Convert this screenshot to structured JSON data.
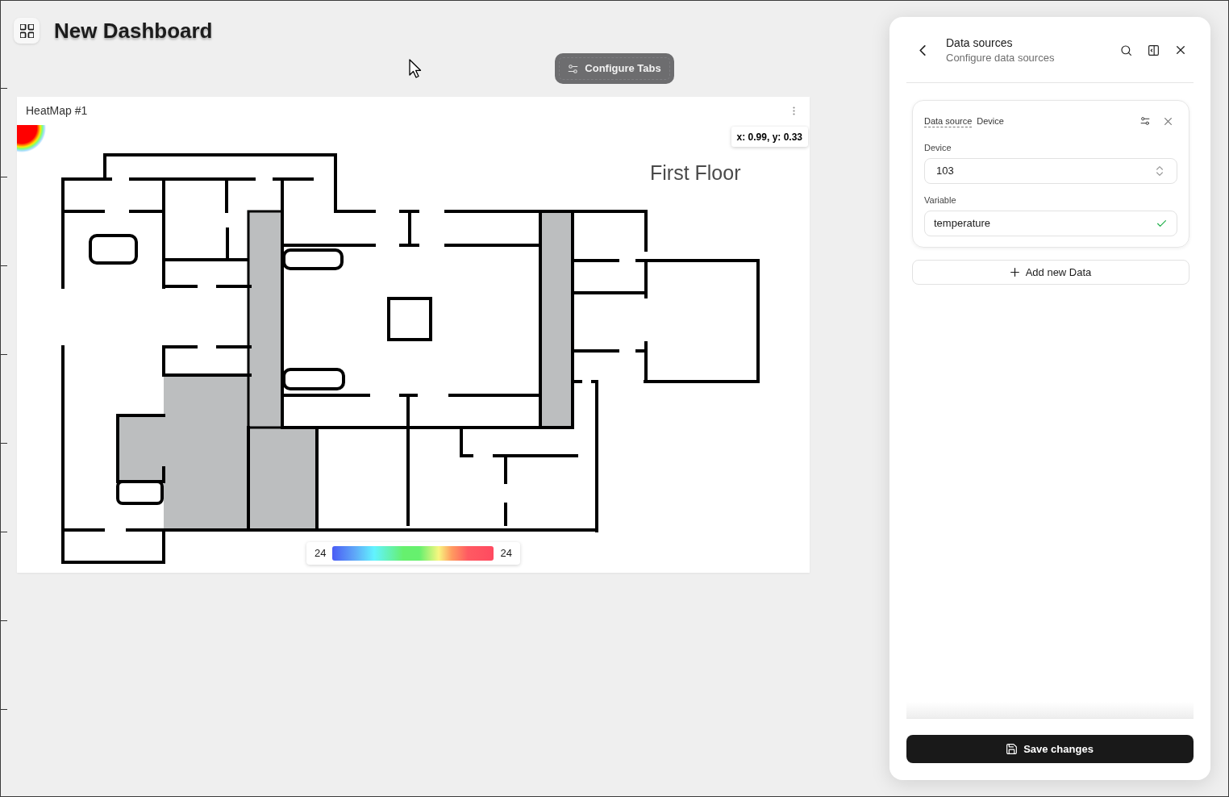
{
  "header": {
    "title": "New Dashboard"
  },
  "toolbar": {
    "configure_button": "Configure Tabs"
  },
  "heatmap": {
    "title": "HeatMap #1",
    "tooltip": "x: 0.99, y: 0.33",
    "floor_label": "First Floor",
    "legend": {
      "min": "24",
      "max": "24"
    }
  },
  "panel": {
    "title": "Data sources",
    "subtitle": "Configure data sources",
    "sources": [
      {
        "label": "Data source",
        "type": "Device",
        "fields": [
          {
            "kind": "select",
            "label": "Device",
            "value": "103"
          },
          {
            "kind": "input",
            "label": "Variable",
            "value": "temperature",
            "valid": true
          }
        ]
      }
    ],
    "add_button": "Add new Data",
    "save_button": "Save changes"
  }
}
